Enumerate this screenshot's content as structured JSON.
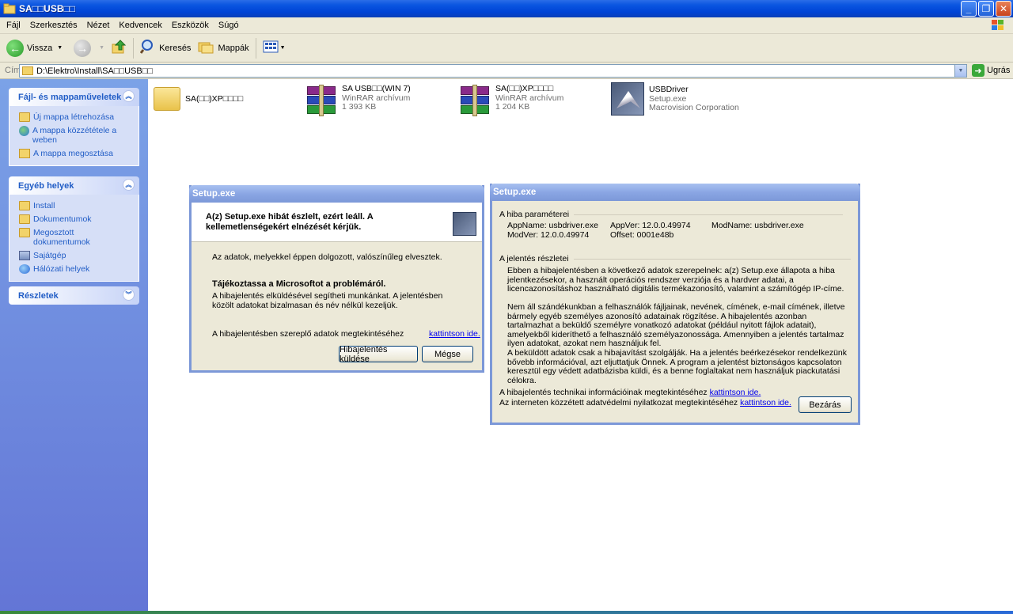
{
  "window": {
    "title": "SA□□USB□□"
  },
  "menu": [
    "Fájl",
    "Szerkesztés",
    "Nézet",
    "Kedvencek",
    "Eszközök",
    "Súgó"
  ],
  "toolbar": {
    "back": "Vissza",
    "search": "Keresés",
    "folders": "Mappák"
  },
  "address": {
    "label": "Cím",
    "path": "D:\\Elektro\\Install\\SA□□USB□□",
    "go": "Ugrás"
  },
  "leftpane": {
    "tasks": {
      "title": "Fájl- és mappaműveletek",
      "items": [
        "Új mappa létrehozása",
        "A mappa közzététele a weben",
        "A mappa megosztása"
      ]
    },
    "places": {
      "title": "Egyéb helyek",
      "items": [
        "Install",
        "Dokumentumok",
        "Megosztott dokumentumok",
        "Sajátgép",
        "Hálózati helyek"
      ]
    },
    "details": {
      "title": "Részletek"
    }
  },
  "files": [
    {
      "name": "SA(□□)XP□□□□",
      "type": "",
      "size": ""
    },
    {
      "name": "SA USB□□(WIN 7)",
      "type": "WinRAR archívum",
      "size": "1 393 KB"
    },
    {
      "name": "SA(□□)XP□□□□",
      "type": "WinRAR archívum",
      "size": "1 204 KB"
    },
    {
      "name": "USBDriver",
      "type": "Setup.exe",
      "size": "Macrovision Corporation"
    }
  ],
  "dialog1": {
    "title": "Setup.exe",
    "header": "A(z) Setup.exe hibát észlelt, ezért leáll. A kellemetlenségekért elnézését kérjük.",
    "body1": "Az adatok, melyekkel éppen dolgozott, valószínűleg elvesztek.",
    "bold": "Tájékoztassa a Microsoftot a problémáról.",
    "body2": "A hibajelentés elküldésével segítheti munkánkat. A jelentésben közölt adatokat bizalmasan és név nélkül kezeljük.",
    "body3": "A hibajelentésben szereplő adatok megtekintéséhez",
    "link": "kattintson ide.",
    "send": "Hibajelentés küldése",
    "cancel": "Mégse"
  },
  "dialog2": {
    "title": "Setup.exe",
    "params_label": "A hiba paraméterei",
    "appname": "AppName: usbdriver.exe",
    "appver": "AppVer: 12.0.0.49974",
    "modname": "ModName: usbdriver.exe",
    "modver": "ModVer: 12.0.0.49974",
    "offset": "Offset: 0001e48b",
    "details_label": "A jelentés részletei",
    "p1": "Ebben a hibajelentésben a következő adatok szerepelnek: a(z) Setup.exe állapota a hiba jelentkezésekor, a használt operációs rendszer verziója és a hardver adatai, a licencazonosításhoz használható digitális termékazonosító, valamint a számítógép IP-címe.",
    "p2": "Nem áll szándékunkban a felhasználók fájljainak, nevének, címének, e-mail címének, illetve bármely egyéb személyes azonosító adatainak rögzítése. A hibajelentés azonban tartalmazhat a beküldő személyre vonatkozó adatokat (például nyitott fájlok adatait), amelyekből kideríthető a felhasználó személyazonossága. Amennyiben a jelentés tartalmaz ilyen adatokat, azokat nem használjuk fel.",
    "p3": "A beküldött adatok csak a hibajavítást szolgálják. Ha a jelentés beérkezésekor rendelkezünk bővebb információval, azt eljuttatjuk Önnek. A program a jelentést biztonságos kapcsolaton keresztül egy védett adatbázisba küldi, és a benne foglaltakat nem használjuk piackutatási célokra.",
    "tech": "A hibajelentés technikai információinak megtekintéséhez",
    "privacy": "Az interneten közzétett adatvédelmi nyilatkozat megtekintéséhez",
    "link": "kattintson ide.",
    "close": "Bezárás"
  }
}
